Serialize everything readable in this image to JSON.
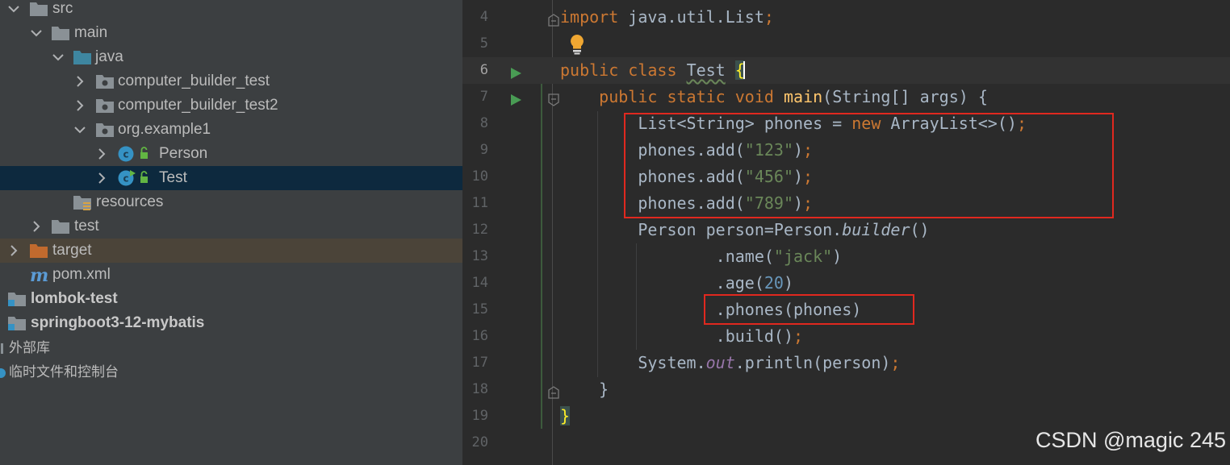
{
  "project_tree": {
    "items": [
      {
        "label": "src",
        "icon": "folder-icon"
      },
      {
        "label": "main",
        "icon": "folder-icon"
      },
      {
        "label": "java",
        "icon": "source-folder-icon"
      },
      {
        "label": "computer_builder_test",
        "icon": "package-icon"
      },
      {
        "label": "computer_builder_test2",
        "icon": "package-icon"
      },
      {
        "label": "org.example1",
        "icon": "package-icon"
      },
      {
        "label": "Person",
        "icon": "java-class-icon"
      },
      {
        "label": "Test",
        "icon": "java-class-runnable-icon"
      },
      {
        "label": "resources",
        "icon": "resources-folder-icon"
      },
      {
        "label": "test",
        "icon": "folder-icon"
      },
      {
        "label": "target",
        "icon": "excluded-folder-icon"
      },
      {
        "label": "pom.xml",
        "icon": "maven-icon"
      },
      {
        "label": "lombok-test",
        "icon": "module-icon"
      },
      {
        "label": "springboot3-12-mybatis",
        "icon": "module-icon"
      },
      {
        "label": "外部库",
        "icon": "library-icon"
      },
      {
        "label": "临时文件和控制台",
        "icon": "scratch-icon"
      }
    ]
  },
  "editor": {
    "line_numbers": [
      "4",
      "5",
      "6",
      "7",
      "8",
      "9",
      "10",
      "11",
      "12",
      "13",
      "14",
      "15",
      "16",
      "17",
      "18",
      "19",
      "20"
    ],
    "tokens": {
      "import_kw": "import",
      "import_path": " java.util.List",
      "semicolon": ";",
      "public": "public",
      "class": "class",
      "class_name": "Test",
      "open_brace": "{",
      "static": "static",
      "void": "void",
      "main": "main",
      "main_params": "(String[] args) {",
      "list_decl": "List<String> phones = ",
      "new": "new",
      "arraylist": " ArrayList<>()",
      "phones_add": "phones.add(",
      "s123": "\"123\"",
      "s456": "\"456\"",
      "s789": "\"789\"",
      "close_paren": ")",
      "person_decl": "Person person=Person.",
      "builder": "builder",
      "empty_call": "()",
      "name_call": ".name(",
      "jack": "\"jack\"",
      "age_call": ".age(",
      "age_val": "20",
      "phones_call": ".phones(phones)",
      "build_call": ".build()",
      "sys": "System.",
      "out": "out",
      "println": ".println(person)",
      "close_brace": "}"
    }
  },
  "colors": {
    "keyword": "#cc7832",
    "string": "#6a8759",
    "number": "#6897bb",
    "method_decl": "#ffc66d",
    "static_field": "#9876aa",
    "highlight_box": "#e0281f",
    "run_icon": "#499c54"
  },
  "watermark": "CSDN @magic 245"
}
